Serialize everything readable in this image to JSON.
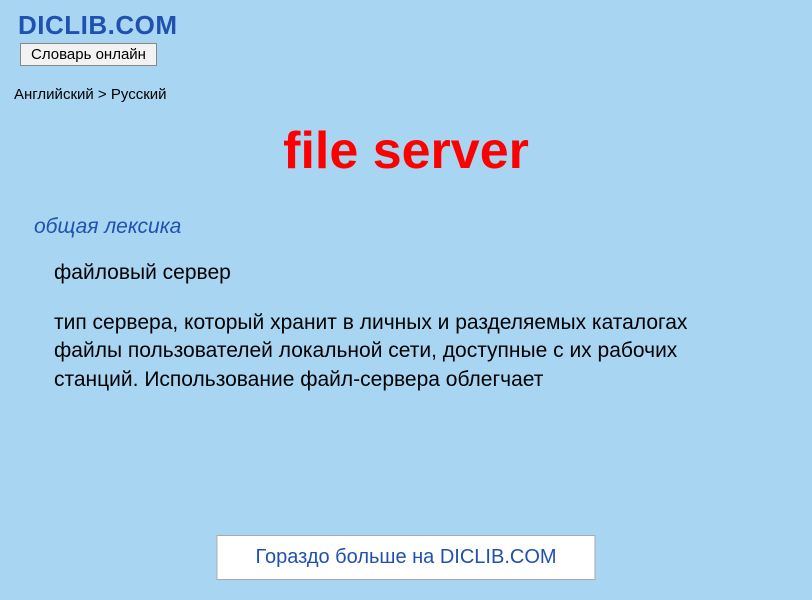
{
  "header": {
    "logo": "DICLIB.COM",
    "tagline": "Словарь онлайн"
  },
  "breadcrumb": "Английский > Русский",
  "entry": {
    "title": "file server",
    "category": "общая лексика",
    "definition": "файловый сервер",
    "description": "тип сервера, который хранит в личных и разделяемых каталогах файлы пользователей локальной сети, доступные с их рабочих станций. Использование файл-сервера облегчает"
  },
  "cta": "Гораздо больше на DICLIB.COM"
}
